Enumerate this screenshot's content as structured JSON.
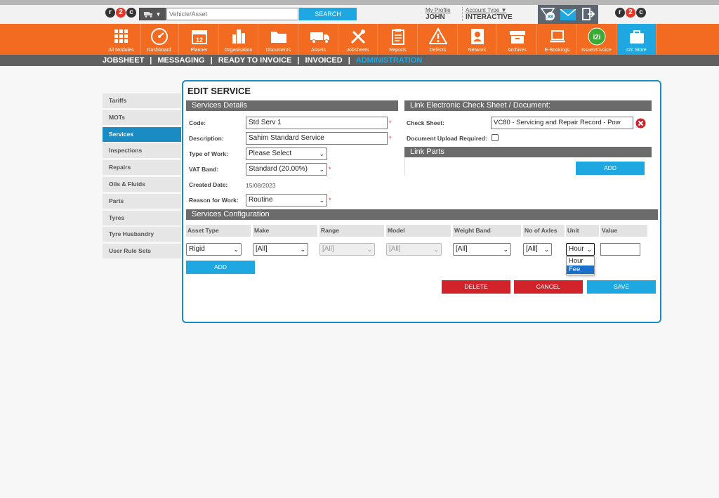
{
  "topbar": {
    "search_placeholder": "Vehicle/Asset",
    "search_label": "SEARCH",
    "profile_link": "My Profile",
    "user_name": "JOHN",
    "account_type_link": "Account Type",
    "account_name": "INTERACTIVE",
    "notification_count": "88"
  },
  "modules": [
    {
      "label": "All Modules",
      "icon": "grid-icon"
    },
    {
      "label": "Dashboard",
      "icon": "speedometer-icon"
    },
    {
      "label": "Planner",
      "icon": "calendar-icon",
      "text": "12"
    },
    {
      "label": "Organisation",
      "icon": "buildings-icon"
    },
    {
      "label": "Documents",
      "icon": "folder-icon"
    },
    {
      "label": "Assets",
      "icon": "truck-icon"
    },
    {
      "label": "Jobsheets",
      "icon": "tools-icon"
    },
    {
      "label": "Reports",
      "icon": "clipboard-icon"
    },
    {
      "label": "Defects",
      "icon": "warning-icon"
    },
    {
      "label": "Network",
      "icon": "contacts-icon"
    },
    {
      "label": "Archives",
      "icon": "archive-box-icon"
    },
    {
      "label": "E-Bookings",
      "icon": "laptop-icon"
    },
    {
      "label": "Issue2Invoice",
      "icon": "i2i-icon",
      "text": "i2i"
    },
    {
      "label": "r2c Store",
      "icon": "briefcase-icon"
    }
  ],
  "subnav": {
    "items": [
      "JOBSHEET",
      "MESSAGING",
      "READY TO INVOICE",
      "INVOICED",
      "ADMINISTRATION"
    ],
    "separator": "|"
  },
  "sidebar": {
    "items": [
      "Tariffs",
      "MOTs",
      "Services",
      "Inspections",
      "Repairs",
      "Oils & Fluids",
      "Parts",
      "Tyres",
      "Tyre Husbandry",
      "User Rule Sets"
    ]
  },
  "page": {
    "title": "EDIT SERVICE",
    "services_details_heading": "Services Details",
    "link_heading": "Link Electronic Check Sheet / Document:",
    "link_parts_heading": "Link Parts",
    "config_heading": "Services Configuration",
    "required_mark": "*"
  },
  "form": {
    "code_label": "Code:",
    "code_value": "Std Serv 1",
    "description_label": "Description:",
    "description_value": "Sahim Standard Service",
    "type_of_work_label": "Type of Work:",
    "type_of_work_value": "Please Select",
    "vat_band_label": "VAT Band:",
    "vat_band_value": "Standard (20.00%)",
    "created_date_label": "Created Date:",
    "created_date_value": "15/08/2023",
    "reason_label": "Reason for Work:",
    "reason_value": "Routine",
    "check_sheet_label": "Check Sheet:",
    "check_sheet_value": "VC80 - Servicing and Repair Record - Pow",
    "doc_upload_label": "Document Upload Required:",
    "add_parts_label": "ADD"
  },
  "config": {
    "columns": [
      "Asset Type",
      "Make",
      "Range",
      "Model",
      "Weight Band",
      "No of Axles",
      "Unit",
      "Value"
    ],
    "row": {
      "asset_type": "Rigid",
      "make": "[All]",
      "range": "[All]",
      "model": "[All]",
      "weight_band": "[All]",
      "axles": "[All]",
      "unit": "Hour",
      "value": ""
    },
    "unit_options": [
      "Hour",
      "Fee"
    ],
    "unit_highlighted": "Fee",
    "add_label": "ADD"
  },
  "actions": {
    "delete_label": "DELETE",
    "cancel_label": "CANCEL",
    "save_label": "SAVE"
  },
  "colors": {
    "brand_orange": "#f26b21",
    "accent_blue": "#1ea7e1",
    "danger_red": "#d2232a",
    "header_grey": "#6b6b6b"
  }
}
